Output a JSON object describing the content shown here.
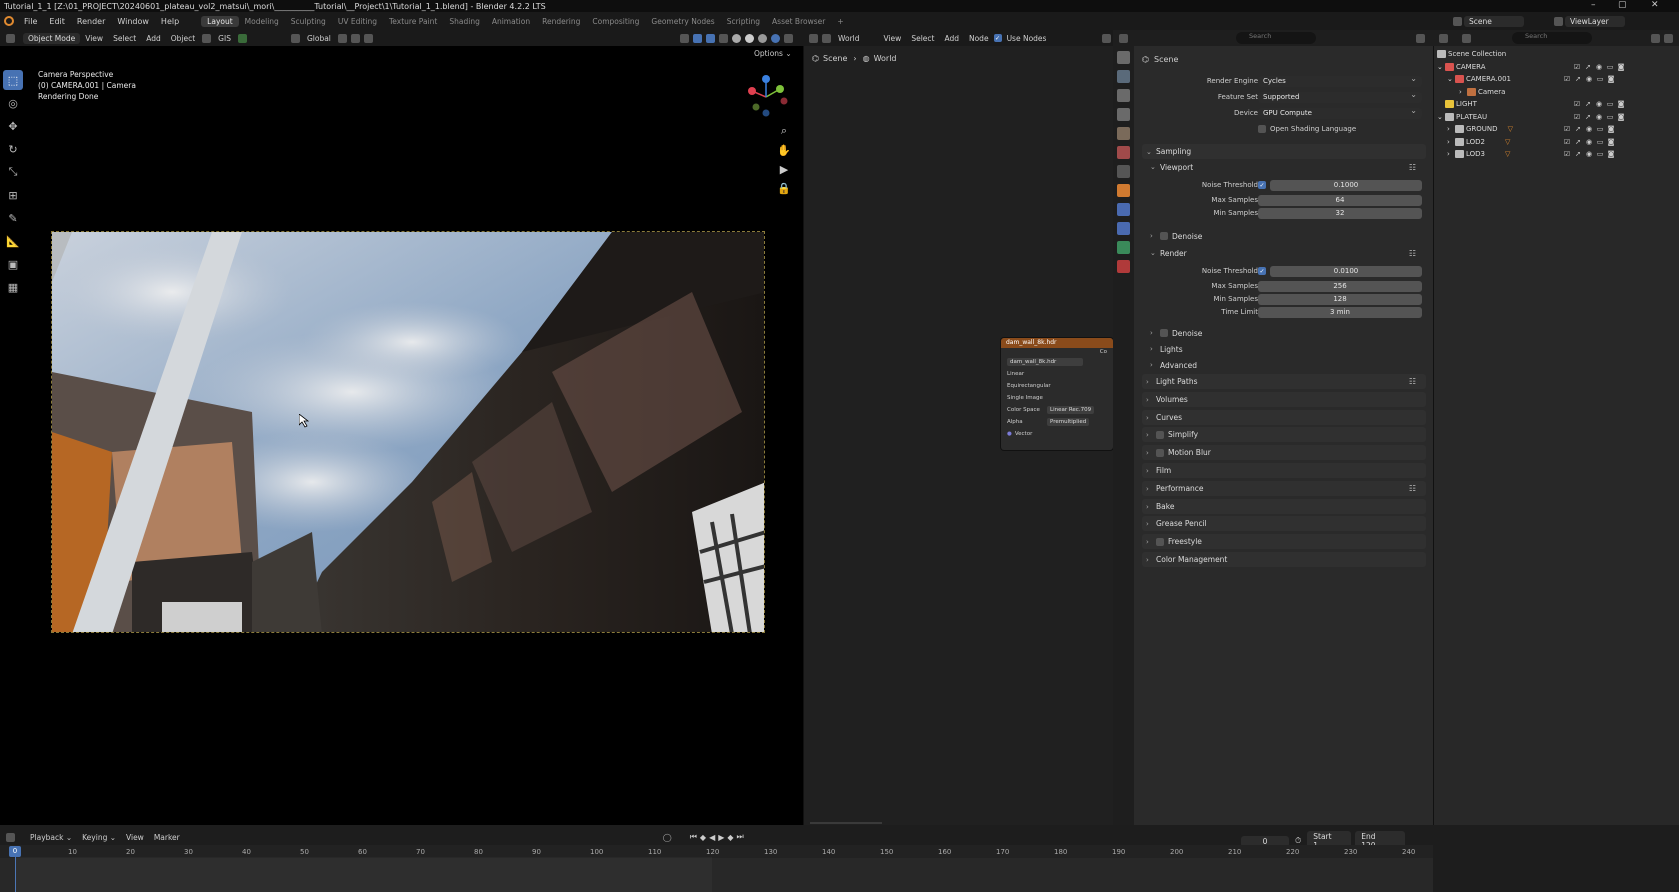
{
  "titlebar": {
    "title": "Tutorial_1_1 [Z:\\01_PROJECT\\20240601_plateau_vol2_matsui\\_mori\\__________Tutorial\\__Project\\1\\Tutorial_1_1.blend] - Blender 4.2.2 LTS",
    "minimize": "–",
    "maximize": "▢",
    "close": "✕"
  },
  "menu": {
    "items": [
      "File",
      "Edit",
      "Render",
      "Window",
      "Help"
    ],
    "workspaces": [
      "Layout",
      "Modeling",
      "Sculpting",
      "UV Editing",
      "Texture Paint",
      "Shading",
      "Animation",
      "Rendering",
      "Compositing",
      "Geometry Nodes",
      "Scripting",
      "Asset Browser"
    ],
    "add_ws": "+",
    "scene": "Scene",
    "view_layer": "ViewLayer"
  },
  "viewport": {
    "mode": "Object Mode",
    "menus": [
      "View",
      "Select",
      "Add",
      "Object"
    ],
    "gis": "GIS",
    "orientation": "Global",
    "options": "Options ⌄",
    "info_line1": "Camera Perspective",
    "info_line2": "(0) CAMERA.001 | Camera",
    "info_line3": "Rendering Done"
  },
  "node_editor": {
    "world_label": "World",
    "menus": [
      "View",
      "Select",
      "Add",
      "Node"
    ],
    "use_nodes": "Use Nodes",
    "breadcrumb_scene": "Scene",
    "breadcrumb_world": "World",
    "node": {
      "title": "dam_wall_8k.hdr",
      "image": "dam_wall_8k.hdr",
      "interp": "Linear",
      "projection": "Equirectangular",
      "source": "Single Image",
      "cs_label": "Color Space",
      "cs_value": "Linear Rec.709",
      "alpha_label": "Alpha",
      "alpha_value": "Premultiplied",
      "vector": "Vector",
      "col": "Co"
    }
  },
  "properties": {
    "search_placeholder": "Search",
    "scene_label": "Scene",
    "render_engine_label": "Render Engine",
    "render_engine": "Cycles",
    "feature_set_label": "Feature Set",
    "feature_set": "Supported",
    "device_label": "Device",
    "device": "GPU Compute",
    "osl": "Open Shading Language",
    "sampling": "Sampling",
    "viewport": "Viewport",
    "noise_threshold_label": "Noise Threshold",
    "vp_noise": "0.1000",
    "max_samples_label": "Max Samples",
    "vp_max": "64",
    "min_samples_label": "Min Samples",
    "vp_min": "32",
    "denoise": "Denoise",
    "render": "Render",
    "r_noise": "0.0100",
    "r_max": "256",
    "r_min": "128",
    "time_limit_label": "Time Limit",
    "r_time": "3 min",
    "lights": "Lights",
    "advanced": "Advanced",
    "panels": [
      "Light Paths",
      "Volumes",
      "Curves",
      "Simplify",
      "Motion Blur",
      "Film",
      "Performance",
      "Bake",
      "Grease Pencil",
      "Freestyle",
      "Color Management"
    ]
  },
  "outliner": {
    "search_placeholder": "Search",
    "rows": [
      {
        "label": "Scene Collection"
      },
      {
        "label": "CAMERA"
      },
      {
        "label": "CAMERA.001"
      },
      {
        "label": "Camera"
      },
      {
        "label": "LIGHT"
      },
      {
        "label": "PLATEAU"
      },
      {
        "label": "GROUND"
      },
      {
        "label": "LOD2"
      },
      {
        "label": "LOD3"
      }
    ]
  },
  "timeline": {
    "menus": [
      "Playback ⌄",
      "Keying ⌄",
      "View",
      "Marker"
    ],
    "current_frame": "0",
    "start_label": "Start",
    "start": "1",
    "end_label": "End",
    "end": "120",
    "playhead": "0",
    "ticks": [
      "10",
      "20",
      "30",
      "40",
      "50",
      "60",
      "70",
      "80",
      "90",
      "100",
      "110",
      "120",
      "130",
      "140",
      "150",
      "160",
      "170",
      "180",
      "190",
      "200",
      "210",
      "220",
      "230",
      "240"
    ]
  },
  "colors": {
    "accent": "#4772b3",
    "node_header": "#8a4b1b",
    "collection": "#e8e8e8",
    "camera_red": "#d9534f",
    "light_yellow": "#e8c33a"
  }
}
